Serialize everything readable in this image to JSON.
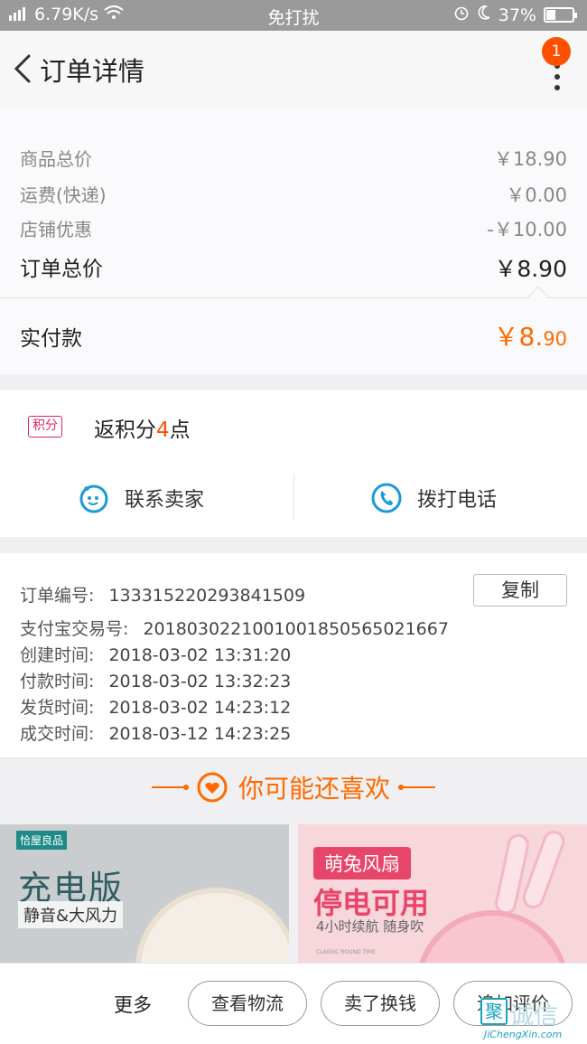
{
  "status_bar": {
    "signal_text": "⁴ᴳ",
    "speed": "6.79K/s",
    "mode": "免打扰",
    "battery_text": "37%",
    "battery_level": 0.37
  },
  "header": {
    "title": "订单详情",
    "badge_count": "1"
  },
  "price": {
    "goods_total_label": "商品总价",
    "goods_total_value": "￥18.90",
    "shipping_label": "运费(快递)",
    "shipping_value": "￥0.00",
    "discount_label": "店铺优惠",
    "discount_value": "-￥10.00",
    "order_total_label": "订单总价",
    "order_total_value": "￥8.90",
    "paid_label": "实付款",
    "paid_value_main": "￥8.",
    "paid_value_cents": "90"
  },
  "points": {
    "tag": "积分",
    "text_prefix": "返积分",
    "amount": "4",
    "text_suffix": "点"
  },
  "actions": {
    "contact_seller": "联系卖家",
    "call_phone": "拨打电话"
  },
  "order_info": {
    "order_no_label": "订单编号:",
    "order_no": "1333152202938415 09",
    "copy_label": "复制",
    "alipay_label": "支付宝交易号:",
    "alipay_no": "2018030221001001850565021667",
    "created_label": "创建时间:",
    "created": "2018-03-02 13:31:20",
    "paid_label": "付款时间:",
    "paid": "2018-03-02 13:32:23",
    "shipped_label": "发货时间:",
    "shipped": "2018-03-02 14:23:12",
    "completed_label": "成交时间:",
    "completed": "2018-03-12 14:23:25"
  },
  "recommend": {
    "title": "你可能还喜欢"
  },
  "products": [
    {
      "brand": "恰屋良品",
      "headline": "充电版",
      "sub": "静音&大风力"
    },
    {
      "tag": "萌兔风扇",
      "headline": "停电可用",
      "sub": "4小时续航  随身吹",
      "small": "CLASSIC ROUND TIME"
    }
  ],
  "bottom_bar": {
    "more": "更多",
    "logistics": "查看物流",
    "resell": "卖了换钱",
    "add_review": "追加评价"
  },
  "watermark": {
    "mark": "聚",
    "text": "诚信",
    "url": "JiChengXin.com"
  },
  "colors": {
    "accent": "#ff6a00",
    "badge": "#ff5000",
    "points_tag": "#e0245e",
    "contact_blue": "#1a9ad6"
  }
}
